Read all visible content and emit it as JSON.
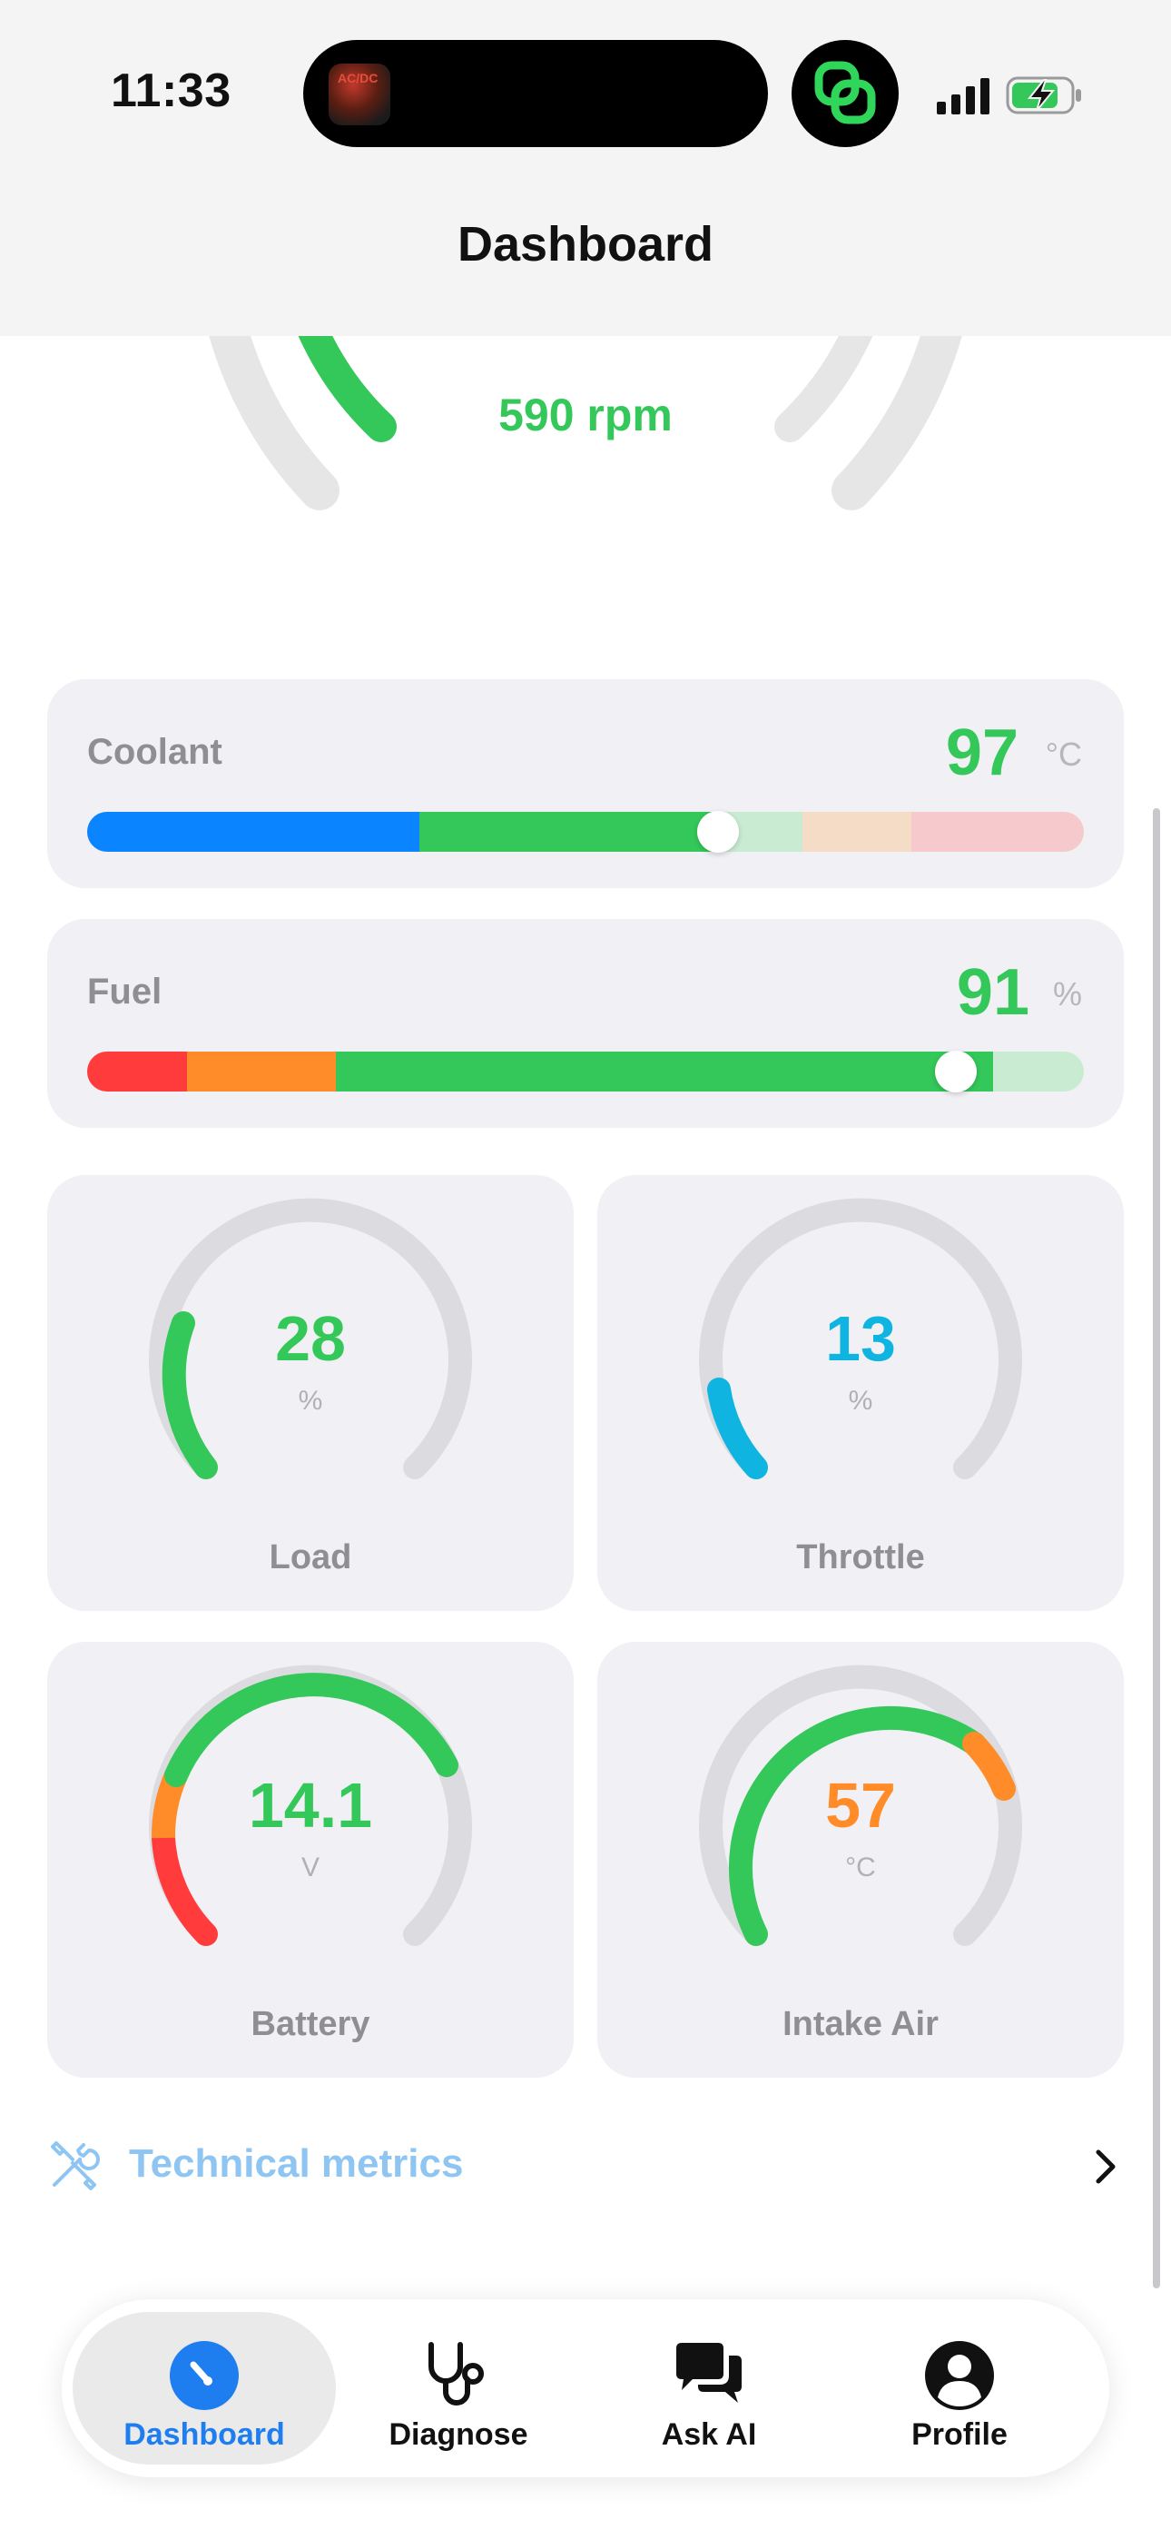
{
  "status_bar": {
    "time": "11:33",
    "island_art_text": "AC/DC"
  },
  "header": {
    "title": "Dashboard"
  },
  "top_gauge": {
    "rpm_text": "590 rpm",
    "color": "#34c759"
  },
  "coolant": {
    "label": "Coolant",
    "value": "97",
    "unit": "°C",
    "level": 0.63,
    "colors": [
      "#0a84ff",
      "#34c759",
      "#c9ebd2",
      "#f5dcc6",
      "#f6c9cc"
    ]
  },
  "fuel": {
    "label": "Fuel",
    "value": "91",
    "unit": "%",
    "level": 0.91,
    "colors": [
      "#ff3b3b",
      "#ff8c28",
      "#34c759",
      "#c9ebd2"
    ]
  },
  "gauges": [
    {
      "id": "load",
      "label": "Load",
      "value": "28",
      "unit": "%",
      "fraction": 0.28,
      "color": "#34c759"
    },
    {
      "id": "throttle",
      "label": "Throttle",
      "value": "13",
      "unit": "%",
      "fraction": 0.13,
      "color": "#0fb5e0"
    },
    {
      "id": "battery",
      "label": "Battery",
      "value": "14.1",
      "unit": "V",
      "fraction": 0.71,
      "color": "#34c759"
    },
    {
      "id": "intake_air",
      "label": "Intake Air",
      "value": "57",
      "unit": "°C",
      "fraction": 0.7,
      "color": "#ff8c28"
    }
  ],
  "technical_metrics": {
    "label": "Technical metrics"
  },
  "tabs": [
    {
      "label": "Dashboard",
      "icon": "speedometer-icon",
      "active": true
    },
    {
      "label": "Diagnose",
      "icon": "stethoscope-icon",
      "active": false
    },
    {
      "label": "Ask AI",
      "icon": "chat-bubbles-icon",
      "active": false
    },
    {
      "label": "Profile",
      "icon": "person-icon",
      "active": false
    }
  ]
}
